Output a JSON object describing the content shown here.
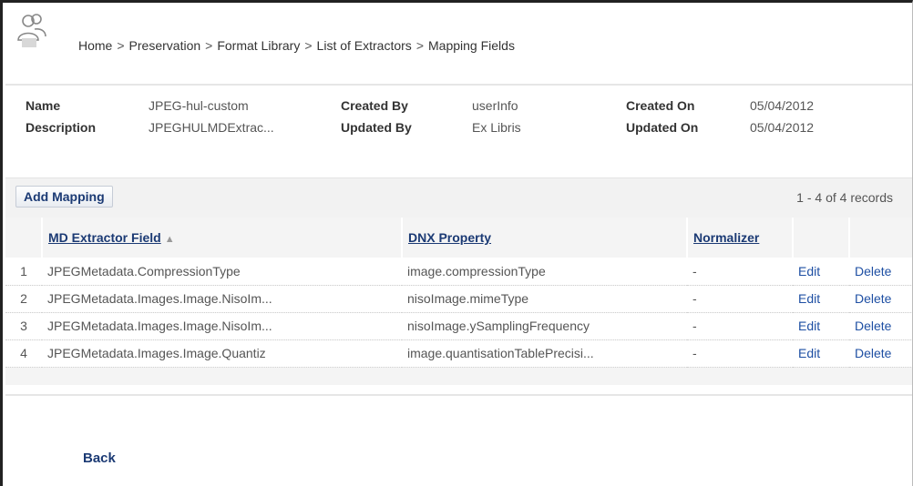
{
  "breadcrumb": [
    "Home",
    "Preservation",
    "Format Library",
    "List of Extractors",
    "Mapping Fields"
  ],
  "breadcrumb_separator": ">",
  "details": {
    "name_label": "Name",
    "name_value": "JPEG-hul-custom",
    "description_label": "Description",
    "description_value": "JPEGHULMDExtrac...",
    "created_by_label": "Created By",
    "created_by_value": "userInfo",
    "updated_by_label": "Updated By",
    "updated_by_value": "Ex Libris",
    "created_on_label": "Created On",
    "created_on_value": "05/04/2012",
    "updated_on_label": "Updated On",
    "updated_on_value": "05/04/2012"
  },
  "toolbar": {
    "add_mapping_label": "Add Mapping",
    "records_text": "1 - 4 of 4 records"
  },
  "table": {
    "headers": {
      "md_field": "MD Extractor Field",
      "dnx_property": "DNX Property",
      "normalizer": "Normalizer"
    },
    "rows": [
      {
        "num": "1",
        "md_field": "JPEGMetadata.CompressionType",
        "dnx": "image.compressionType",
        "normalizer": "-",
        "edit": "Edit",
        "delete": "Delete"
      },
      {
        "num": "2",
        "md_field": "JPEGMetadata.Images.Image.NisoIm...",
        "dnx": "nisoImage.mimeType",
        "normalizer": "-",
        "edit": "Edit",
        "delete": "Delete"
      },
      {
        "num": "3",
        "md_field": "JPEGMetadata.Images.Image.NisoIm...",
        "dnx": "nisoImage.ySamplingFrequency",
        "normalizer": "-",
        "edit": "Edit",
        "delete": "Delete"
      },
      {
        "num": "4",
        "md_field": "JPEGMetadata.Images.Image.Quantiz",
        "dnx": "image.quantisationTablePrecisi...",
        "normalizer": "-",
        "edit": "Edit",
        "delete": "Delete"
      }
    ]
  },
  "back_label": "Back",
  "icons": {
    "header": "users-icon",
    "sort": "sort-ascending-icon"
  },
  "colors": {
    "link": "#1b3a74",
    "action": "#1e4fa3",
    "band": "#f2f2f2"
  }
}
